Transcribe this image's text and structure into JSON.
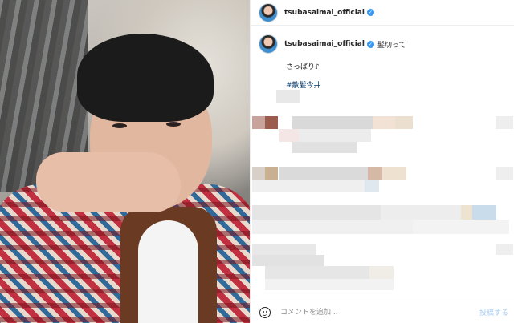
{
  "post": {
    "username": "tsubasaimai_official",
    "caption_title": "髪切って",
    "caption_body": "さっぱり♪",
    "hashtag": "#散髪今井"
  },
  "comment_box": {
    "placeholder": "コメントを追加...",
    "post_label": "投稿する"
  },
  "colors": {
    "verified": "#3897f0",
    "hashtag": "#00376b",
    "post_button_disabled": "#a7cbf2"
  },
  "icons": {
    "verified": "verified-badge-icon",
    "emoji": "emoji-smile-icon"
  }
}
